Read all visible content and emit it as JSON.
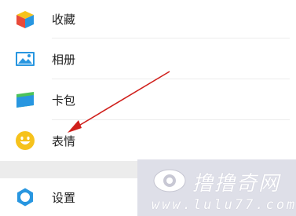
{
  "menu": {
    "items": [
      {
        "label": "收藏",
        "icon": "favorites-cube-icon"
      },
      {
        "label": "相册",
        "icon": "photo-album-icon"
      },
      {
        "label": "卡包",
        "icon": "card-wallet-icon"
      },
      {
        "label": "表情",
        "icon": "smiley-emoji-icon"
      },
      {
        "label": "设置",
        "icon": "settings-gear-icon"
      }
    ]
  },
  "annotation": {
    "color": "#d0201c"
  },
  "watermark": {
    "title": "撸撸奇网",
    "url": "www.lulu77.com"
  },
  "colors": {
    "accent_blue": "#2896e0",
    "accent_yellow": "#f6c21c",
    "accent_green": "#4cc25a",
    "accent_red": "#e84a3a"
  }
}
